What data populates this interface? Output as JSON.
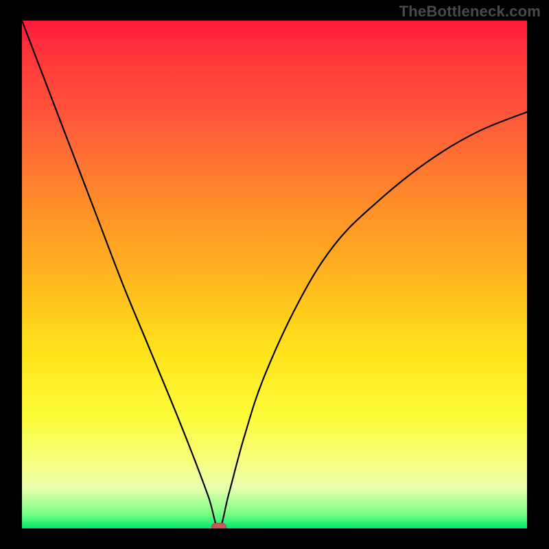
{
  "watermark": "TheBottleneck.com",
  "chart_data": {
    "type": "line",
    "title": "",
    "xlabel": "",
    "ylabel": "",
    "xlim": [
      0,
      100
    ],
    "ylim": [
      0,
      100
    ],
    "grid": false,
    "legend": false,
    "marker": {
      "x": 39,
      "y": 0,
      "color": "#c65a5a"
    },
    "background_gradient": {
      "direction": "vertical",
      "stops": [
        {
          "pos": 0,
          "color": "#ff1a3a"
        },
        {
          "pos": 50,
          "color": "#ffb41f"
        },
        {
          "pos": 78,
          "color": "#fdfd3a"
        },
        {
          "pos": 100,
          "color": "#00e86a"
        }
      ]
    },
    "series": [
      {
        "name": "curve",
        "x": [
          0,
          5,
          10,
          15,
          20,
          25,
          30,
          34,
          37,
          39,
          41,
          44,
          48,
          55,
          62,
          70,
          80,
          90,
          100
        ],
        "values": [
          100,
          87,
          74,
          61,
          48,
          36,
          24,
          14,
          6,
          0,
          7,
          18,
          30,
          45,
          56,
          64,
          72,
          78,
          82
        ]
      }
    ]
  }
}
